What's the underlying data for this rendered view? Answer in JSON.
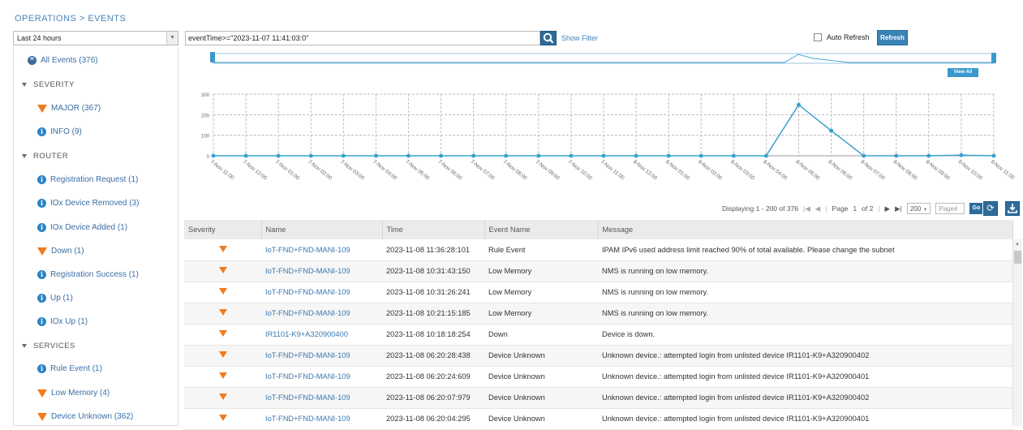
{
  "breadcrumb": "OPERATIONS > EVENTS",
  "time_range": {
    "selected": "Last 24 hours"
  },
  "query": {
    "value": "eventTime>=\"2023-11-07 11:41:03:0\""
  },
  "show_filter": "Show Filter",
  "auto_refresh": {
    "label": "Auto Refresh",
    "checked": false
  },
  "refresh_label": "Refresh",
  "view_all": "View All",
  "left_panel": {
    "all_events": "All Events (376)",
    "severity_header": "SEVERITY",
    "severity_items": [
      "MAJOR (367)",
      "INFO (9)"
    ],
    "router_header": "ROUTER",
    "router_items": [
      {
        "label": "Registration Request (1)",
        "icon": "info-icon"
      },
      {
        "label": "IOx Device Removed (3)",
        "icon": "info-icon"
      },
      {
        "label": "IOx Device Added (1)",
        "icon": "info-icon"
      },
      {
        "label": "Down (1)",
        "icon": "major-icon"
      },
      {
        "label": "Registration Success (1)",
        "icon": "info-icon"
      },
      {
        "label": "Up (1)",
        "icon": "info-icon"
      },
      {
        "label": "IOx Up (1)",
        "icon": "info-icon"
      }
    ],
    "services_header": "SERVICES",
    "services_items": [
      {
        "label": "Rule Event (1)",
        "icon": "info-icon"
      },
      {
        "label": "Low Memory (4)",
        "icon": "major-icon"
      },
      {
        "label": "Device Unknown (362)",
        "icon": "major-icon"
      }
    ]
  },
  "chart_data": {
    "type": "line",
    "categories": [
      "7-Nov 11:00",
      "7-Nov 12:00",
      "7-Nov 01:00",
      "7-Nov 02:00",
      "7-Nov 03:00",
      "7-Nov 04:00",
      "7-Nov 05:00",
      "7-Nov 06:00",
      "7-Nov 07:00",
      "7-Nov 08:00",
      "7-Nov 09:00",
      "7-Nov 10:00",
      "7-Nov 11:00",
      "8-Nov 12:00",
      "8-Nov 01:00",
      "8-Nov 02:00",
      "8-Nov 03:00",
      "8-Nov 04:00",
      "8-Nov 05:00",
      "8-Nov 06:00",
      "8-Nov 07:00",
      "8-Nov 08:00",
      "8-Nov 09:00",
      "8-Nov 10:00",
      "8-Nov 11:00"
    ],
    "values": [
      0,
      0,
      0,
      0,
      0,
      0,
      0,
      0,
      0,
      0,
      0,
      0,
      0,
      0,
      0,
      0,
      0,
      0,
      248,
      122,
      0,
      0,
      0,
      3,
      0
    ],
    "yticks": [
      0,
      100,
      200,
      300
    ],
    "ylim": [
      0,
      300
    ],
    "grid": true,
    "color": "#3aa0d0"
  },
  "pager": {
    "displaying": "Displaying 1 - 200 of 376",
    "page_label": "Page",
    "page_value": "1",
    "of_label": "of 2",
    "page_size": "200",
    "page_input_placeholder": "Page#",
    "go_label": "Go"
  },
  "table": {
    "headers": [
      "Severity",
      "Name",
      "Time",
      "Event Name",
      "Message"
    ],
    "rows": [
      {
        "name": "IoT-FND+FND-MANI-109",
        "time": "2023-11-08 11:36:28:101",
        "event": "Rule Event",
        "message": "IPAM IPv6 used address limit reached 90% of total available. Please change the subnet"
      },
      {
        "name": "IoT-FND+FND-MANI-109",
        "time": "2023-11-08 10:31:43:150",
        "event": "Low Memory",
        "message": "NMS is running on low memory."
      },
      {
        "name": "IoT-FND+FND-MANI-109",
        "time": "2023-11-08 10:31:26:241",
        "event": "Low Memory",
        "message": "NMS is running on low memory."
      },
      {
        "name": "IoT-FND+FND-MANI-109",
        "time": "2023-11-08 10:21:15:185",
        "event": "Low Memory",
        "message": "NMS is running on low memory."
      },
      {
        "name": "IR1101-K9+A320900400",
        "time": "2023-11-08 10:18:18:254",
        "event": "Down",
        "message": "Device is down."
      },
      {
        "name": "IoT-FND+FND-MANI-109",
        "time": "2023-11-08 06:20:28:438",
        "event": "Device Unknown",
        "message": "Unknown device.: attempted login from unlisted device IR1101-K9+A320900402"
      },
      {
        "name": "IoT-FND+FND-MANI-109",
        "time": "2023-11-08 06:20:24:609",
        "event": "Device Unknown",
        "message": "Unknown device.: attempted login from unlisted device IR1101-K9+A320900401"
      },
      {
        "name": "IoT-FND+FND-MANI-109",
        "time": "2023-11-08 06:20:07:979",
        "event": "Device Unknown",
        "message": "Unknown device.: attempted login from unlisted device IR1101-K9+A320900402"
      },
      {
        "name": "IoT-FND+FND-MANI-109",
        "time": "2023-11-08 06:20:04:295",
        "event": "Device Unknown",
        "message": "Unknown device.: attempted login from unlisted device IR1101-K9+A320900401"
      }
    ]
  }
}
